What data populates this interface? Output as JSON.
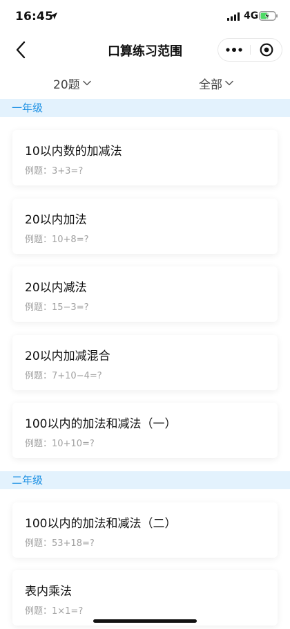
{
  "status": {
    "time": "16:45",
    "network": "4G"
  },
  "nav": {
    "title": "口算练习范围"
  },
  "filters": {
    "count": "20题",
    "scope": "全部"
  },
  "sections": [
    {
      "title": "一年级",
      "items": [
        {
          "title": "10以内数的加减法",
          "example": "例题：3+3=?"
        },
        {
          "title": "20以内加法",
          "example": "例题：10+8=?"
        },
        {
          "title": "20以内减法",
          "example": "例题：15−3=?"
        },
        {
          "title": "20以内加减混合",
          "example": "例题：7+10−4=?"
        },
        {
          "title": "100以内的加法和减法（一）",
          "example": "例题：10+10=?"
        }
      ]
    },
    {
      "title": "二年级",
      "items": [
        {
          "title": "100以内的加法和减法（二）",
          "example": "例题：53+18=?"
        },
        {
          "title": "表内乘法",
          "example": "例题：1×1=?"
        }
      ]
    }
  ],
  "icons": {
    "back": "chevron-left-icon",
    "more": "more-dots-icon",
    "close": "target-circle-icon",
    "dropdown": "chevron-down-icon"
  },
  "colors": {
    "accent": "#1a8fe3",
    "section_bg": "#e3f2fd",
    "battery": "#4cd964"
  }
}
